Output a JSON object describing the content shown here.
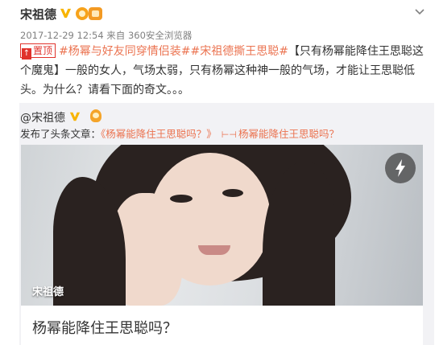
{
  "post": {
    "author": "宋祖德",
    "meta": "2017-12-29 12:54 来自 360安全浏览器",
    "pin_label": "置顶",
    "tags": "#杨幂与好友同穿情侣装##宋祖德撕王思聪#",
    "body": "【只有杨幂能降住王思聪这个魔鬼】一般的女人，气场太弱，只有杨幂这种神一般的气场，才能让王思聪低头。为什么？请看下面的奇文。。。"
  },
  "repost": {
    "author": "@宋祖德",
    "line_prefix": "发布了头条文章：",
    "article_link": "《杨幂能降住王思聪吗？》",
    "link_label": "杨幂能降住王思聪吗？",
    "photo_caption": "宋祖德",
    "card_title": "杨幂能降住王思聪吗？"
  },
  "icons": {
    "verified": "verified-v-icon",
    "member": "member-badge-icon",
    "expand": "chevron-down-icon",
    "flash": "lightning-icon",
    "link": "link-icon"
  },
  "colors": {
    "accent": "#eb7350",
    "verified": "#f8b400",
    "pin": "#e0322b",
    "repost_bg": "#f2f2f5"
  }
}
